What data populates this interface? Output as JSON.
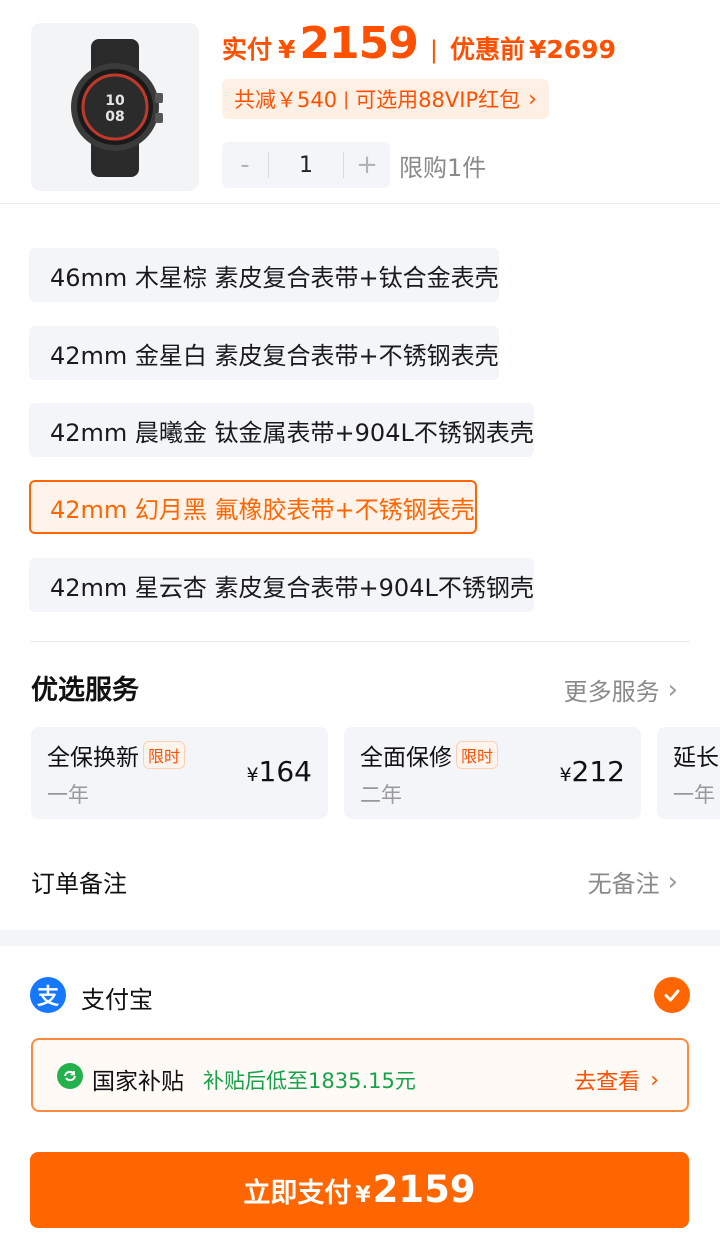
{
  "product": {
    "pay_label": "实付",
    "currency": "¥",
    "pay_amount": "2159",
    "original_label": "优惠前",
    "original_price": "¥2699",
    "discount_text": "共减￥540",
    "discount_link": "可选用88VIP红包",
    "quantity": "1",
    "minus": "-",
    "plus": "+",
    "limit_text": "限购1件"
  },
  "variants": [
    {
      "label": "46mm 木星棕 素皮复合表带+钛合金表壳"
    },
    {
      "label": "42mm 金星白 素皮复合表带+不锈钢表壳"
    },
    {
      "label": "42mm 晨曦金 钛金属表带+904L不锈钢表壳"
    },
    {
      "label": "42mm 幻月黑 氟橡胶表带+不锈钢表壳",
      "selected": true
    },
    {
      "label": "42mm 星云杏 素皮复合表带+904L不锈钢壳"
    }
  ],
  "services": {
    "title": "优选服务",
    "more_label": "更多服务",
    "cards": [
      {
        "name": "全保换新",
        "tag": "限时",
        "period": "一年",
        "currency": "¥",
        "price": "164"
      },
      {
        "name": "全面保修",
        "tag": "限时",
        "period": "二年",
        "currency": "¥",
        "price": "212"
      },
      {
        "name": "延长",
        "tag": "",
        "period": "一年",
        "currency": "",
        "price": ""
      }
    ]
  },
  "order_note": {
    "label": "订单备注",
    "value": "无备注"
  },
  "payment": {
    "alipay_glyph": "支",
    "method": "支付宝",
    "selected": true
  },
  "subsidy": {
    "label": "国家补贴",
    "description": "补贴后低至1835.15元",
    "link": "去查看"
  },
  "pay_button": {
    "label": "立即支付",
    "currency": "¥",
    "amount": "2159"
  },
  "colors": {
    "accent": "#ff6600",
    "price": "#ff5000",
    "subsidy_green": "#16a34a",
    "alipay_blue": "#1677ff"
  },
  "icons": [
    "watch-thumbnail",
    "chevron-right-icon",
    "alipay-icon",
    "check-icon",
    "subsidy-icon"
  ]
}
